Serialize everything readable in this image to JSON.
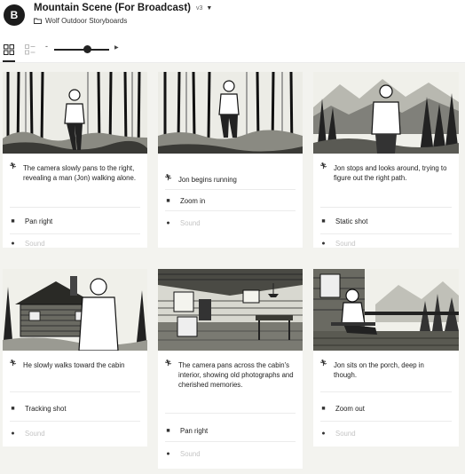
{
  "app": {
    "logo_letter": "B",
    "project_title": "Mountain Scene (For Broadcast)",
    "version": "v3",
    "folder": "Wolf Outdoor Storyboards"
  },
  "icons": {
    "logo": "brand-logo",
    "folder": "folder-icon",
    "grid_view": "grid-view-icon",
    "list_view": "list-view-icon",
    "action": "running-figure-icon",
    "camera": "video-camera-icon",
    "sound": "microphone-icon"
  },
  "toolbar": {
    "zoom_minus": "-",
    "zoom_level": 0.6
  },
  "frames": [
    {
      "scene": "forest-man-walking",
      "description": "The camera slowly pans to the right, revealing a man (Jon) walking alone.",
      "camera": "Pan right",
      "sound": "Sound"
    },
    {
      "scene": "forest-man-running",
      "description": "Jon begins running",
      "camera": "Zoom in",
      "sound": "Sound"
    },
    {
      "scene": "mountain-man-standing",
      "description": "Jon stops and looks around, trying to figure out the right path.",
      "camera": "Static shot",
      "sound": "Sound"
    },
    {
      "scene": "man-walking-to-cabin",
      "description": "He slowly walks toward the cabin",
      "camera": "Tracking shot",
      "sound": "Sound"
    },
    {
      "scene": "cabin-interior",
      "description": "The camera pans across the cabin's interior, showing old photographs and cherished memories.",
      "camera": "Pan right",
      "sound": "Sound"
    },
    {
      "scene": "man-sitting-on-porch",
      "description": "Jon sits on the porch, deep in though.",
      "camera": "Zoom out",
      "sound": "Sound"
    }
  ]
}
